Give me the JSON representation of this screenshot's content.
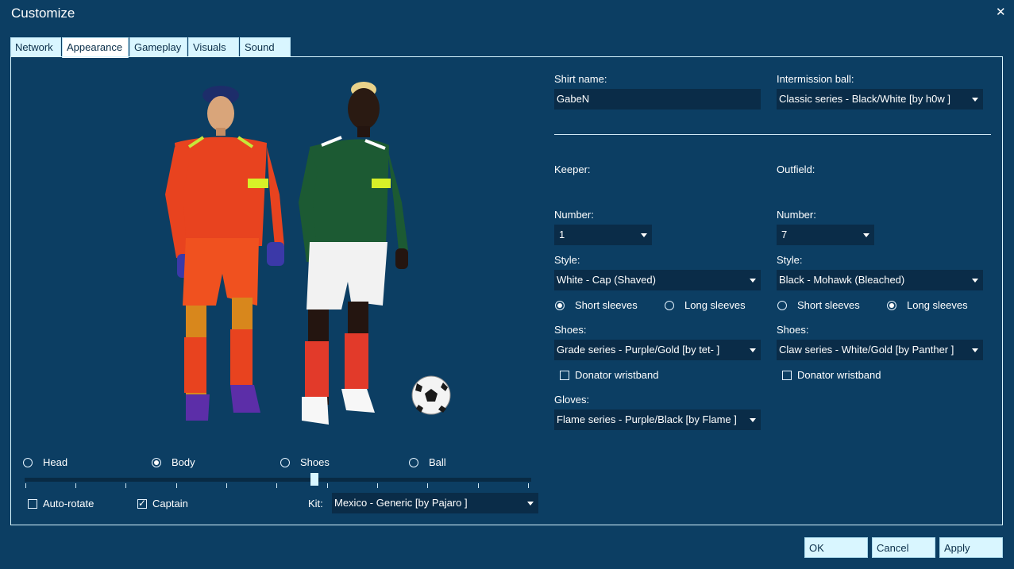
{
  "window": {
    "title": "Customize",
    "close_label": "✕"
  },
  "tabs": [
    {
      "label": "Network"
    },
    {
      "label": "Appearance"
    },
    {
      "label": "Gameplay"
    },
    {
      "label": "Visuals"
    },
    {
      "label": "Sound"
    }
  ],
  "active_tab": "Appearance",
  "preview": {
    "view_options": [
      {
        "label": "Head",
        "selected": false
      },
      {
        "label": "Body",
        "selected": true
      },
      {
        "label": "Shoes",
        "selected": false
      },
      {
        "label": "Ball",
        "selected": false
      }
    ],
    "zoom_fraction": 0.57,
    "auto_rotate": {
      "label": "Auto-rotate",
      "checked": false
    },
    "captain": {
      "label": "Captain",
      "checked": true
    },
    "kit": {
      "label": "Kit:",
      "value": "Mexico - Generic   [by Pajaro ]"
    }
  },
  "shirt_name": {
    "label": "Shirt name:",
    "value": "GabeN"
  },
  "intermission_ball": {
    "label": "Intermission ball:",
    "value": "Classic series - Black/White   [by h0w ]"
  },
  "keeper": {
    "heading": "Keeper:",
    "number_label": "Number:",
    "number": "1",
    "style_label": "Style:",
    "style": "White - Cap (Shaved)",
    "short_sleeves": {
      "label": "Short sleeves",
      "selected": true
    },
    "long_sleeves": {
      "label": "Long sleeves",
      "selected": false
    },
    "shoes_label": "Shoes:",
    "shoes": "Grade series - Purple/Gold   [by tet- ]",
    "donator_wristband": {
      "label": "Donator wristband",
      "checked": false
    },
    "gloves_label": "Gloves:",
    "gloves": "Flame series - Purple/Black   [by Flame ]"
  },
  "outfield": {
    "heading": "Outfield:",
    "number_label": "Number:",
    "number": "7",
    "style_label": "Style:",
    "style": "Black - Mohawk (Bleached)",
    "short_sleeves": {
      "label": "Short sleeves",
      "selected": false
    },
    "long_sleeves": {
      "label": "Long sleeves",
      "selected": true
    },
    "shoes_label": "Shoes:",
    "shoes": "Claw series - White/Gold   [by Panther ]",
    "donator_wristband": {
      "label": "Donator wristband",
      "checked": false
    }
  },
  "buttons": {
    "ok": "OK",
    "cancel": "Cancel",
    "apply": "Apply"
  },
  "colors": {
    "background": "#0c3e63",
    "field": "#0a2c48",
    "tab": "#d9f6ff",
    "keeper_kit": "#e8431f",
    "outfield_kit": "#1c5a33"
  }
}
